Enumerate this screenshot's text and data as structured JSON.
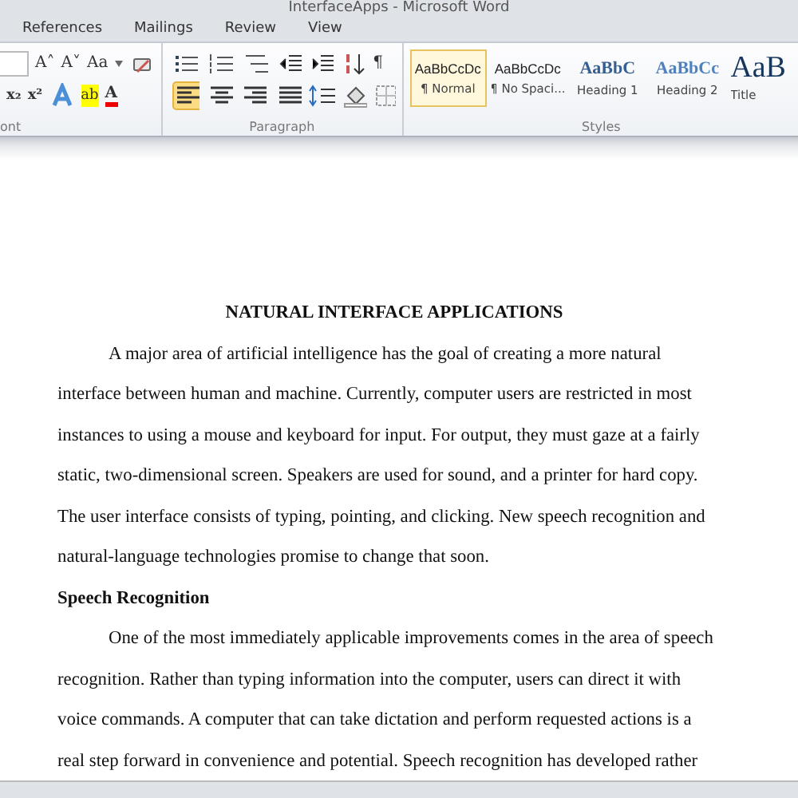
{
  "window": {
    "title": "InterfaceApps - Microsoft Word"
  },
  "tabs": [
    {
      "label": "References",
      "selected": false
    },
    {
      "label": "Mailings",
      "selected": false
    },
    {
      "label": "Review",
      "selected": false
    },
    {
      "label": "View",
      "selected": false
    }
  ],
  "ribbon": {
    "font_group": {
      "label": "ont",
      "row1": [
        {
          "kind": "sizebox"
        },
        {
          "kind": "text",
          "label": "A˄"
        },
        {
          "kind": "text",
          "label": "A˅"
        },
        {
          "kind": "case",
          "label": "Aa"
        },
        {
          "kind": "clear"
        }
      ],
      "row2": [
        {
          "kind": "text",
          "label": "x₂"
        },
        {
          "kind": "text",
          "label": "x²"
        },
        {
          "kind": "effects"
        },
        {
          "kind": "highlight",
          "label": "ab"
        },
        {
          "kind": "fontcolor",
          "label": "A"
        }
      ]
    },
    "paragraph_group": {
      "label": "Paragraph",
      "row1": [
        {
          "kind": "bullets"
        },
        {
          "kind": "numbering"
        },
        {
          "kind": "multilevel"
        },
        {
          "kind": "outdent"
        },
        {
          "kind": "indent"
        },
        {
          "kind": "sort"
        },
        {
          "kind": "pilcrow",
          "label": "¶"
        }
      ],
      "row2": [
        {
          "kind": "alignleft",
          "selected": true
        },
        {
          "kind": "aligncenter",
          "selected": false
        },
        {
          "kind": "alignright",
          "selected": false
        },
        {
          "kind": "justify",
          "selected": false
        },
        {
          "kind": "spacing"
        },
        {
          "kind": "shading"
        },
        {
          "kind": "borders"
        }
      ]
    },
    "styles_group": {
      "label": "Styles",
      "items": [
        {
          "kind": "normal",
          "preview": "AaBbCcDc",
          "name": "¶ Normal",
          "selected": true
        },
        {
          "kind": "normal",
          "preview": "AaBbCcDc",
          "name": "¶ No Spaci...",
          "selected": false
        },
        {
          "kind": "heading1",
          "preview": "AaBbC",
          "name": "Heading 1",
          "selected": false
        },
        {
          "kind": "heading2",
          "preview": "AaBbCc",
          "name": "Heading 2",
          "selected": false
        },
        {
          "kind": "title",
          "preview": "AaB",
          "name": "Title",
          "selected": false
        }
      ]
    }
  },
  "document": {
    "blocks": [
      {
        "kind": "title",
        "text": "NATURAL INTERFACE APPLICATIONS"
      },
      {
        "kind": "paragraph",
        "text": "A major area of artificial intelligence has the goal of creating a more natural interface between human and machine. Currently, computer users are restricted in most instances to using a mouse and keyboard for input. For output, they must gaze at a fairly static, two-dimensional screen. Speakers are used for sound, and a printer for hard copy. The user interface consists of typing, pointing, and clicking. New speech recognition and natural-language technologies promise to change that soon."
      },
      {
        "kind": "heading",
        "text": "Speech Recognition"
      },
      {
        "kind": "paragraph",
        "text": "One of the most immediately applicable improvements comes in the area of speech recognition. Rather than typing information into the computer, users can direct it with voice commands. A computer that can take dictation and perform requested actions is a real step forward in convenience and potential. Speech recognition has developed rather"
      }
    ]
  }
}
